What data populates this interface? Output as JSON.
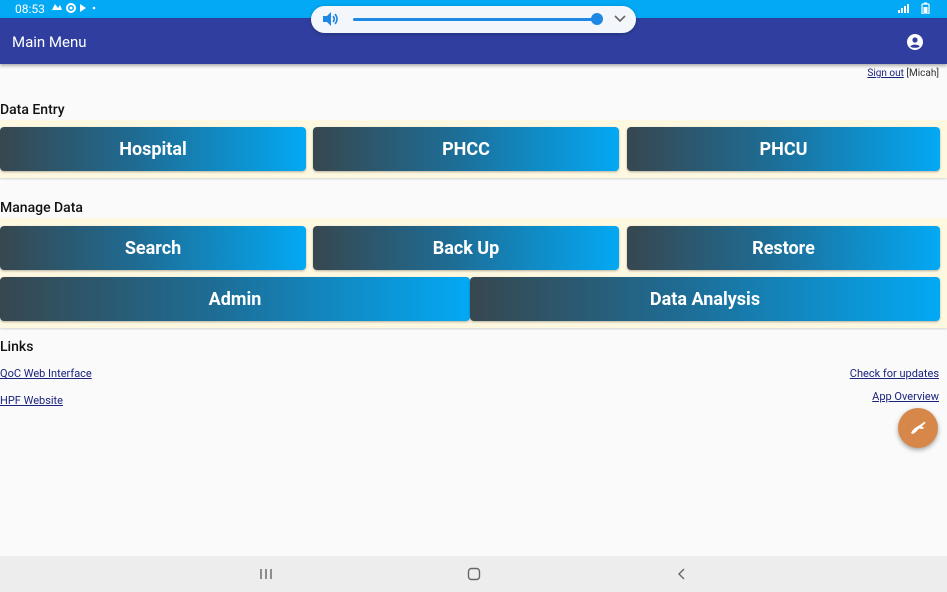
{
  "status_bar": {
    "time": "08:53"
  },
  "app_bar": {
    "title": "Main Menu"
  },
  "signout": {
    "link": "Sign out",
    "user": " [Micah]"
  },
  "sections": {
    "data_entry": "Data Entry",
    "manage_data": "Manage Data",
    "links": "Links"
  },
  "data_entry": {
    "hospital": "Hospital",
    "phcc": "PHCC",
    "phcu": "PHCU"
  },
  "manage_data": {
    "search": "Search",
    "backup": "Back Up",
    "restore": "Restore",
    "admin": "Admin",
    "analysis": "Data Analysis"
  },
  "links": {
    "qoc": "QoC Web Interface",
    "hpf": "HPF Website",
    "updates": "Check for updates",
    "overview": "App Overview"
  },
  "colors": {
    "status_bar": "#03a9f4",
    "app_bar": "#303f9f",
    "panel": "#fff8e1",
    "fab": "#d7874a"
  }
}
